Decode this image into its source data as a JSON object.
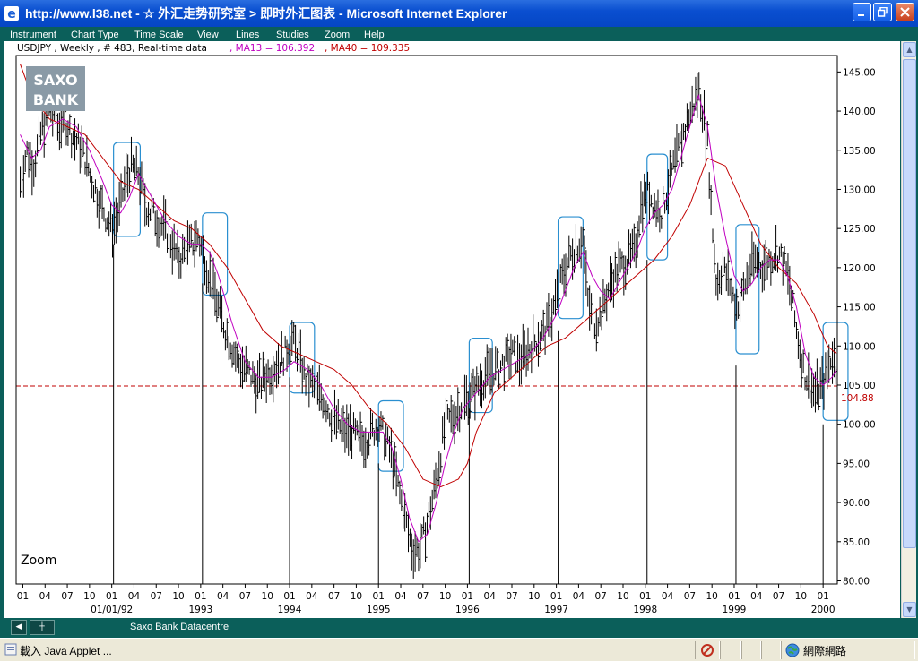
{
  "window": {
    "title": "http://www.l38.net - ☆ 外汇走势研究室 > 即时外汇图表 - Microsoft Internet Explorer"
  },
  "menu": [
    "Instrument",
    "Chart Type",
    "Time Scale",
    "View",
    "Lines",
    "Studies",
    "Zoom",
    "Help"
  ],
  "chart_header": {
    "instrument": "USDJPY , Weekly , # 483, Real-time data",
    "ma13": ", MA13 = 106.392",
    "ma40": ", MA40 = 109.335"
  },
  "logo": {
    "line1": "SAXO",
    "line2": "BANK"
  },
  "zoom_label": "Zoom",
  "footer": {
    "datacentre": "Saxo Bank Datacentre"
  },
  "status": {
    "text": "載入 Java Applet ...",
    "zone": "網際網路"
  },
  "colors": {
    "frame": "#0b5f5a",
    "ma13": "#c000c0",
    "ma40": "#c00000",
    "price": "#000000",
    "highlight_box": "#2a8fd0",
    "reference_line": "#c00000"
  },
  "chart_data": {
    "type": "ohlc",
    "instrument": "USDJPY",
    "timeframe": "Weekly",
    "ylim": [
      80,
      147
    ],
    "y_ticks": [
      "145.00",
      "140.00",
      "135.00",
      "130.00",
      "125.00",
      "120.00",
      "115.00",
      "110.00",
      "105.00",
      "100.00",
      "95.00",
      "90.00",
      "85.00",
      "80.00"
    ],
    "reference_label": "104.88",
    "reference_value": 104.88,
    "x_month_ticks": [
      {
        "label": "01",
        "t": 1991.0
      },
      {
        "label": "04",
        "t": 1991.25
      },
      {
        "label": "07",
        "t": 1991.5
      },
      {
        "label": "10",
        "t": 1991.75
      },
      {
        "label": "01",
        "t": 1992.0
      },
      {
        "label": "04",
        "t": 1992.25
      },
      {
        "label": "07",
        "t": 1992.5
      },
      {
        "label": "10",
        "t": 1992.75
      },
      {
        "label": "01",
        "t": 1993.0
      },
      {
        "label": "04",
        "t": 1993.25
      },
      {
        "label": "07",
        "t": 1993.5
      },
      {
        "label": "10",
        "t": 1993.75
      },
      {
        "label": "01",
        "t": 1994.0
      },
      {
        "label": "04",
        "t": 1994.25
      },
      {
        "label": "07",
        "t": 1994.5
      },
      {
        "label": "10",
        "t": 1994.75
      },
      {
        "label": "01",
        "t": 1995.0
      },
      {
        "label": "04",
        "t": 1995.25
      },
      {
        "label": "07",
        "t": 1995.5
      },
      {
        "label": "10",
        "t": 1995.75
      },
      {
        "label": "01",
        "t": 1996.0
      },
      {
        "label": "04",
        "t": 1996.25
      },
      {
        "label": "07",
        "t": 1996.5
      },
      {
        "label": "10",
        "t": 1996.75
      },
      {
        "label": "01",
        "t": 1997.0
      },
      {
        "label": "04",
        "t": 1997.25
      },
      {
        "label": "07",
        "t": 1997.5
      },
      {
        "label": "10",
        "t": 1997.75
      },
      {
        "label": "01",
        "t": 1998.0
      },
      {
        "label": "04",
        "t": 1998.25
      },
      {
        "label": "07",
        "t": 1998.5
      },
      {
        "label": "10",
        "t": 1998.75
      },
      {
        "label": "01",
        "t": 1999.0
      },
      {
        "label": "04",
        "t": 1999.25
      },
      {
        "label": "07",
        "t": 1999.5
      },
      {
        "label": "10",
        "t": 1999.75
      },
      {
        "label": "01",
        "t": 2000.0
      }
    ],
    "x_year_ticks": [
      {
        "label": "01/01/92",
        "t": 1992.0
      },
      {
        "label": "1993",
        "t": 1993.0
      },
      {
        "label": "1994",
        "t": 1994.0
      },
      {
        "label": "1995",
        "t": 1995.0
      },
      {
        "label": "1996",
        "t": 1996.0
      },
      {
        "label": "1997",
        "t": 1997.0
      },
      {
        "label": "1998",
        "t": 1998.0
      },
      {
        "label": "1999",
        "t": 1999.0
      },
      {
        "label": "2000",
        "t": 2000.0
      }
    ],
    "price_path": [
      [
        1990.97,
        131
      ],
      [
        1991.05,
        135
      ],
      [
        1991.12,
        133
      ],
      [
        1991.2,
        137
      ],
      [
        1991.3,
        140
      ],
      [
        1991.4,
        138
      ],
      [
        1991.47,
        139
      ],
      [
        1991.55,
        137
      ],
      [
        1991.62,
        136
      ],
      [
        1991.7,
        134
      ],
      [
        1991.78,
        131
      ],
      [
        1991.85,
        129
      ],
      [
        1991.92,
        127
      ],
      [
        1992.0,
        125
      ],
      [
        1992.08,
        127
      ],
      [
        1992.15,
        131
      ],
      [
        1992.22,
        133
      ],
      [
        1992.3,
        132
      ],
      [
        1992.38,
        128
      ],
      [
        1992.45,
        127
      ],
      [
        1992.52,
        126
      ],
      [
        1992.6,
        125
      ],
      [
        1992.68,
        123
      ],
      [
        1992.75,
        121
      ],
      [
        1992.82,
        122
      ],
      [
        1992.9,
        123
      ],
      [
        1992.97,
        124
      ],
      [
        1993.05,
        121
      ],
      [
        1993.12,
        118
      ],
      [
        1993.2,
        115
      ],
      [
        1993.28,
        112
      ],
      [
        1993.35,
        110
      ],
      [
        1993.42,
        108
      ],
      [
        1993.5,
        107
      ],
      [
        1993.58,
        106
      ],
      [
        1993.65,
        105
      ],
      [
        1993.72,
        106
      ],
      [
        1993.8,
        107
      ],
      [
        1993.87,
        108
      ],
      [
        1993.95,
        109
      ],
      [
        1994.02,
        111
      ],
      [
        1994.1,
        109
      ],
      [
        1994.17,
        106
      ],
      [
        1994.25,
        105
      ],
      [
        1994.32,
        104
      ],
      [
        1994.4,
        103
      ],
      [
        1994.47,
        101
      ],
      [
        1994.55,
        100
      ],
      [
        1994.62,
        99
      ],
      [
        1994.7,
        99
      ],
      [
        1994.78,
        98
      ],
      [
        1994.85,
        98
      ],
      [
        1994.92,
        99
      ],
      [
        1995.0,
        100
      ],
      [
        1995.08,
        98
      ],
      [
        1995.15,
        96
      ],
      [
        1995.22,
        92
      ],
      [
        1995.3,
        88
      ],
      [
        1995.38,
        84
      ],
      [
        1995.45,
        84
      ],
      [
        1995.52,
        86
      ],
      [
        1995.6,
        90
      ],
      [
        1995.68,
        95
      ],
      [
        1995.75,
        100
      ],
      [
        1995.83,
        101
      ],
      [
        1995.9,
        102
      ],
      [
        1995.97,
        103
      ],
      [
        1996.05,
        104
      ],
      [
        1996.12,
        105
      ],
      [
        1996.2,
        106
      ],
      [
        1996.28,
        107
      ],
      [
        1996.35,
        107
      ],
      [
        1996.42,
        108
      ],
      [
        1996.5,
        109
      ],
      [
        1996.58,
        108
      ],
      [
        1996.65,
        109
      ],
      [
        1996.72,
        110
      ],
      [
        1996.8,
        111
      ],
      [
        1996.88,
        112
      ],
      [
        1996.95,
        114
      ],
      [
        1997.02,
        117
      ],
      [
        1997.1,
        120
      ],
      [
        1997.18,
        122
      ],
      [
        1997.25,
        123
      ],
      [
        1997.3,
        124
      ],
      [
        1997.35,
        116
      ],
      [
        1997.42,
        113
      ],
      [
        1997.5,
        114
      ],
      [
        1997.58,
        117
      ],
      [
        1997.65,
        119
      ],
      [
        1997.72,
        120
      ],
      [
        1997.8,
        121
      ],
      [
        1997.88,
        122
      ],
      [
        1997.95,
        128
      ],
      [
        1998.02,
        130
      ],
      [
        1998.1,
        128
      ],
      [
        1998.18,
        127
      ],
      [
        1998.25,
        130
      ],
      [
        1998.32,
        133
      ],
      [
        1998.4,
        136
      ],
      [
        1998.48,
        139
      ],
      [
        1998.55,
        141
      ],
      [
        1998.6,
        143
      ],
      [
        1998.65,
        140
      ],
      [
        1998.7,
        136
      ],
      [
        1998.75,
        126
      ],
      [
        1998.8,
        118
      ],
      [
        1998.87,
        120
      ],
      [
        1998.95,
        118
      ],
      [
        1999.02,
        115
      ],
      [
        1999.1,
        117
      ],
      [
        1999.18,
        120
      ],
      [
        1999.25,
        121
      ],
      [
        1999.32,
        120
      ],
      [
        1999.4,
        121
      ],
      [
        1999.48,
        122
      ],
      [
        1999.55,
        121
      ],
      [
        1999.62,
        118
      ],
      [
        1999.7,
        112
      ],
      [
        1999.78,
        107
      ],
      [
        1999.85,
        105
      ],
      [
        1999.92,
        104
      ],
      [
        2000.0,
        105
      ],
      [
        2000.05,
        107
      ],
      [
        2000.1,
        109
      ],
      [
        2000.15,
        107
      ]
    ],
    "ma13_path": [
      [
        1990.97,
        137
      ],
      [
        1991.1,
        134
      ],
      [
        1991.2,
        135
      ],
      [
        1991.3,
        138
      ],
      [
        1991.45,
        139
      ],
      [
        1991.6,
        138
      ],
      [
        1991.75,
        135
      ],
      [
        1991.9,
        131
      ],
      [
        1992.0,
        128
      ],
      [
        1992.1,
        127
      ],
      [
        1992.2,
        129
      ],
      [
        1992.3,
        132
      ],
      [
        1992.45,
        129
      ],
      [
        1992.6,
        126
      ],
      [
        1992.75,
        124
      ],
      [
        1992.9,
        123
      ],
      [
        1993.0,
        123
      ],
      [
        1993.1,
        122
      ],
      [
        1993.2,
        119
      ],
      [
        1993.35,
        113
      ],
      [
        1993.5,
        108
      ],
      [
        1993.65,
        106
      ],
      [
        1993.8,
        106
      ],
      [
        1993.95,
        107
      ],
      [
        1994.05,
        108
      ],
      [
        1994.2,
        107
      ],
      [
        1994.35,
        105
      ],
      [
        1994.5,
        102
      ],
      [
        1994.65,
        100
      ],
      [
        1994.8,
        99
      ],
      [
        1994.95,
        99
      ],
      [
        1995.05,
        99
      ],
      [
        1995.15,
        97
      ],
      [
        1995.25,
        93
      ],
      [
        1995.35,
        88
      ],
      [
        1995.45,
        85
      ],
      [
        1995.55,
        86
      ],
      [
        1995.65,
        90
      ],
      [
        1995.75,
        95
      ],
      [
        1995.85,
        99
      ],
      [
        1995.95,
        102
      ],
      [
        1996.1,
        104
      ],
      [
        1996.25,
        106
      ],
      [
        1996.4,
        107
      ],
      [
        1996.55,
        108
      ],
      [
        1996.7,
        109
      ],
      [
        1996.85,
        111
      ],
      [
        1997.0,
        114
      ],
      [
        1997.1,
        117
      ],
      [
        1997.2,
        120
      ],
      [
        1997.3,
        122
      ],
      [
        1997.4,
        119
      ],
      [
        1997.5,
        117
      ],
      [
        1997.6,
        116
      ],
      [
        1997.7,
        118
      ],
      [
        1997.8,
        120
      ],
      [
        1997.9,
        122
      ],
      [
        1998.0,
        125
      ],
      [
        1998.1,
        127
      ],
      [
        1998.2,
        128
      ],
      [
        1998.3,
        130
      ],
      [
        1998.4,
        134
      ],
      [
        1998.5,
        138
      ],
      [
        1998.6,
        142
      ],
      [
        1998.7,
        138
      ],
      [
        1998.8,
        130
      ],
      [
        1998.9,
        124
      ],
      [
        1999.0,
        119
      ],
      [
        1999.1,
        117
      ],
      [
        1999.2,
        118
      ],
      [
        1999.3,
        120
      ],
      [
        1999.4,
        121
      ],
      [
        1999.5,
        121
      ],
      [
        1999.6,
        119
      ],
      [
        1999.7,
        115
      ],
      [
        1999.8,
        109
      ],
      [
        1999.9,
        106
      ],
      [
        2000.0,
        105
      ],
      [
        2000.1,
        106
      ],
      [
        2000.15,
        107
      ]
    ],
    "ma40_path": [
      [
        1990.97,
        146
      ],
      [
        1991.1,
        142
      ],
      [
        1991.3,
        139
      ],
      [
        1991.5,
        138
      ],
      [
        1991.7,
        137
      ],
      [
        1991.9,
        134
      ],
      [
        1992.1,
        131
      ],
      [
        1992.3,
        130
      ],
      [
        1992.5,
        128
      ],
      [
        1992.7,
        126
      ],
      [
        1992.9,
        125
      ],
      [
        1993.1,
        123
      ],
      [
        1993.3,
        120
      ],
      [
        1993.5,
        116
      ],
      [
        1993.7,
        112
      ],
      [
        1993.9,
        110
      ],
      [
        1994.1,
        109
      ],
      [
        1994.3,
        108
      ],
      [
        1994.5,
        107
      ],
      [
        1994.7,
        105
      ],
      [
        1994.9,
        102
      ],
      [
        1995.1,
        100
      ],
      [
        1995.3,
        97
      ],
      [
        1995.5,
        93
      ],
      [
        1995.7,
        92
      ],
      [
        1995.9,
        93
      ],
      [
        1996.0,
        95
      ],
      [
        1996.1,
        99
      ],
      [
        1996.3,
        104
      ],
      [
        1996.5,
        106
      ],
      [
        1996.7,
        108
      ],
      [
        1996.9,
        110
      ],
      [
        1997.1,
        111
      ],
      [
        1997.3,
        113
      ],
      [
        1997.5,
        115
      ],
      [
        1997.7,
        117
      ],
      [
        1997.9,
        119
      ],
      [
        1998.1,
        121
      ],
      [
        1998.3,
        124
      ],
      [
        1998.5,
        128
      ],
      [
        1998.7,
        134
      ],
      [
        1998.9,
        133
      ],
      [
        1999.1,
        128
      ],
      [
        1999.3,
        123
      ],
      [
        1999.5,
        120
      ],
      [
        1999.7,
        118
      ],
      [
        1999.9,
        114
      ],
      [
        2000.05,
        110
      ],
      [
        2000.15,
        109
      ]
    ],
    "highlight_boxes": [
      {
        "t0": 1992.02,
        "t1": 1992.32,
        "y0": 124,
        "y1": 136
      },
      {
        "t0": 1993.02,
        "t1": 1993.3,
        "y0": 116.5,
        "y1": 127
      },
      {
        "t0": 1994.0,
        "t1": 1994.28,
        "y0": 104,
        "y1": 113
      },
      {
        "t0": 1995.0,
        "t1": 1995.28,
        "y0": 94,
        "y1": 103
      },
      {
        "t0": 1996.02,
        "t1": 1996.28,
        "y0": 101.5,
        "y1": 111
      },
      {
        "t0": 1997.02,
        "t1": 1997.3,
        "y0": 113.5,
        "y1": 126.5
      },
      {
        "t0": 1998.02,
        "t1": 1998.25,
        "y0": 121,
        "y1": 134.5
      },
      {
        "t0": 1999.02,
        "t1": 1999.28,
        "y0": 109,
        "y1": 125.5
      },
      {
        "t0": 2000.0,
        "t1": 2000.28,
        "y0": 100.5,
        "y1": 113
      }
    ],
    "vertical_markers": [
      {
        "t": 1992.02,
        "y": 123
      },
      {
        "t": 1993.02,
        "y": 118
      },
      {
        "t": 1994.0,
        "y": 106
      },
      {
        "t": 1995.0,
        "y": 95
      },
      {
        "t": 1996.02,
        "y": 102
      },
      {
        "t": 1997.02,
        "y": 112
      },
      {
        "t": 1998.02,
        "y": 121
      },
      {
        "t": 1999.02,
        "y": 107.5
      },
      {
        "t": 2000.0,
        "y": 100
      }
    ]
  }
}
